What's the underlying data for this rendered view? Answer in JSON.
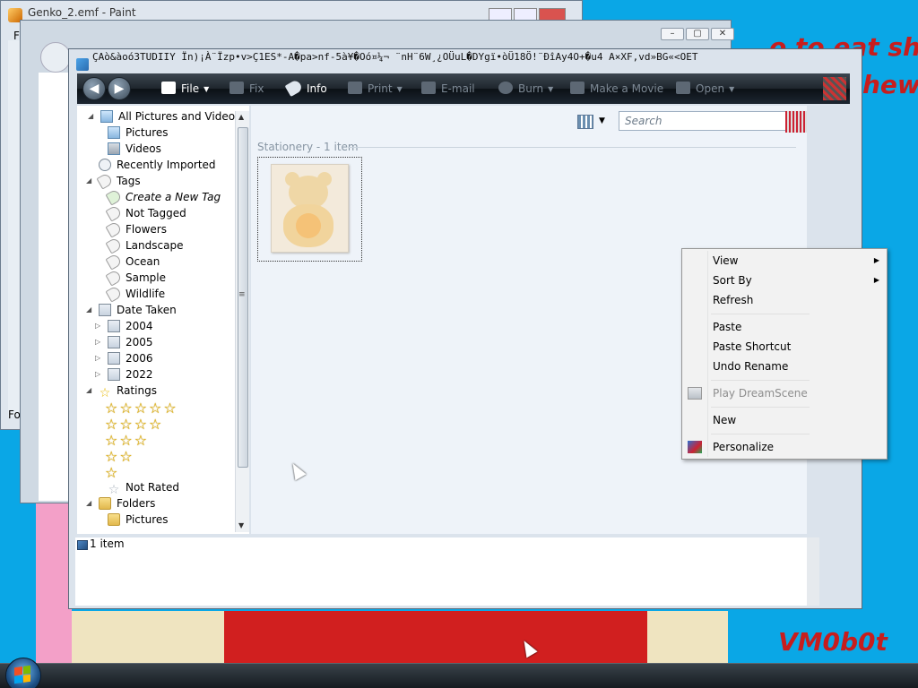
{
  "paint_window": {
    "title": "Genko_2.emf - Paint",
    "menu_first": "F",
    "side_label": "Fo"
  },
  "wallpaper": {
    "text_line1": "o to eat sh",
    "text_line2": "hew",
    "signature": "VM0b0t"
  },
  "gallery": {
    "title": "ÇAò&àoó3TUDIIY  Ïn)¡À¨Ïzp•v>Ç1ES*-A�pa>nf-5à¥�Oó¤¼¬ ¨nH¨6W¸¿OÜuL�DYgï•òÜ18Ö!¨ÐîAy4O+�u4   A×XF,vd»BG«<OET",
    "toolbar": {
      "file": "File",
      "fix": "Fix",
      "info": "Info",
      "print": "Print",
      "email": "E-mail",
      "burn": "Burn",
      "make_movie": "Make a Movie",
      "open": "Open"
    },
    "nav": {
      "all_pictures": "All Pictures and Videos",
      "pictures": "Pictures",
      "videos": "Videos",
      "recently_imported": "Recently Imported",
      "tags": "Tags",
      "create_tag": "Create a New Tag",
      "not_tagged": "Not Tagged",
      "tag_items": [
        "Flowers",
        "Landscape",
        "Ocean",
        "Sample",
        "Wildlife"
      ],
      "date_taken": "Date Taken",
      "years": [
        "2004",
        "2005",
        "2006",
        "2022"
      ],
      "ratings": "Ratings",
      "rating_levels": [
        5,
        4,
        3,
        2,
        1
      ],
      "not_rated": "Not Rated",
      "folders": "Folders",
      "folder_pictures": "Pictures"
    },
    "search_placeholder": "Search",
    "group_label": "Stationery - 1 item",
    "status": "1 item"
  },
  "context_menu": {
    "items": [
      {
        "label": "View",
        "submenu": true,
        "enabled": true
      },
      {
        "label": "Sort By",
        "submenu": true,
        "enabled": true
      },
      {
        "label": "Refresh",
        "submenu": false,
        "enabled": true
      },
      {
        "label": "Paste",
        "submenu": false,
        "enabled": true
      },
      {
        "label": "Paste Shortcut",
        "submenu": false,
        "enabled": true
      },
      {
        "label": "Undo Rename",
        "submenu": false,
        "enabled": true
      },
      {
        "label": "Play DreamScene",
        "submenu": false,
        "enabled": false
      },
      {
        "label": "New",
        "submenu": false,
        "enabled": true
      },
      {
        "label": "Personalize",
        "submenu": false,
        "enabled": true
      }
    ]
  },
  "colors": {
    "desktop": "#0aa7e6",
    "toolbar_dark": "#1e252c",
    "star_gold": "#e5b000",
    "wallpaper_red": "#c71d1d"
  },
  "icons": {
    "submenu_arrow": "chevron-right-icon",
    "dreamscene": "dreamscene-icon",
    "personalize": "personalize-icon"
  }
}
